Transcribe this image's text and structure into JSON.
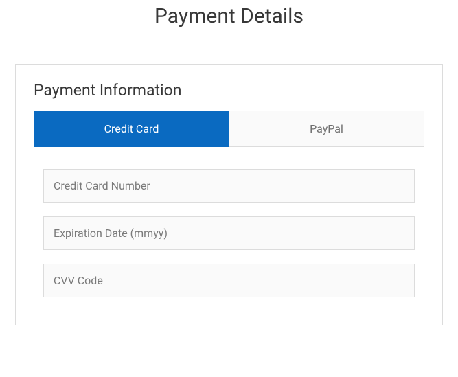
{
  "page": {
    "title": "Payment Details"
  },
  "section": {
    "title": "Payment Information"
  },
  "tabs": [
    {
      "label": "Credit Card",
      "active": true
    },
    {
      "label": "PayPal",
      "active": false
    }
  ],
  "fields": {
    "card_number": {
      "placeholder": "Credit Card Number",
      "value": ""
    },
    "expiration": {
      "placeholder": "Expiration Date (mmyy)",
      "value": ""
    },
    "cvv": {
      "placeholder": "CVV Code",
      "value": ""
    }
  }
}
